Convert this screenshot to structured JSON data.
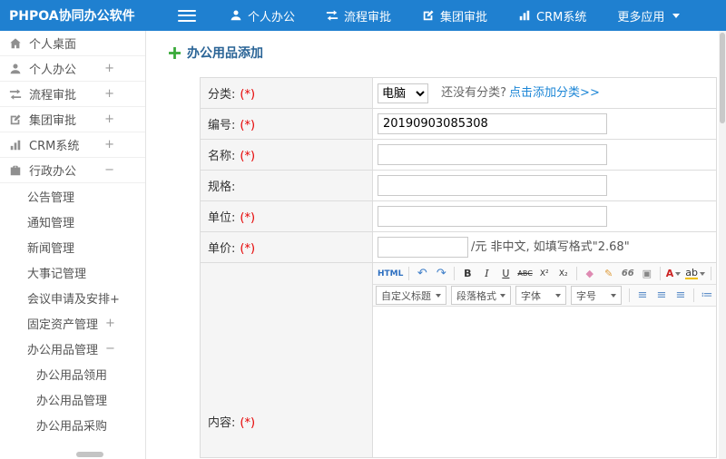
{
  "colors": {
    "topbar": "#1f80d0",
    "link": "#1c86d6",
    "required": "#e60000",
    "title": "#2a6496",
    "plus_icon": "#3aaa3a"
  },
  "topbar": {
    "logo": "PHPOA协同办公软件",
    "menu_icon": "hamburger-icon",
    "nav": [
      {
        "label": "个人办公",
        "icon": "user-icon"
      },
      {
        "label": "流程审批",
        "icon": "flow-icon"
      },
      {
        "label": "集团审批",
        "icon": "edit-icon"
      },
      {
        "label": "CRM系统",
        "icon": "chart-icon"
      },
      {
        "label": "更多应用",
        "icon": "caret-down-icon"
      }
    ]
  },
  "sidebar": {
    "items": [
      {
        "label": "个人桌面",
        "icon": "desktop-icon",
        "suffix": ""
      },
      {
        "label": "个人办公",
        "icon": "user-icon",
        "suffix": "+"
      },
      {
        "label": "流程审批",
        "icon": "flow-icon",
        "suffix": "+"
      },
      {
        "label": "集团审批",
        "icon": "edit-icon",
        "suffix": "+"
      },
      {
        "label": "CRM系统",
        "icon": "chart-icon",
        "suffix": "+"
      },
      {
        "label": "行政办公",
        "icon": "office-icon",
        "suffix": "−"
      },
      {
        "label": "公告管理",
        "suffix": ""
      },
      {
        "label": "通知管理",
        "suffix": ""
      },
      {
        "label": "新闻管理",
        "suffix": ""
      },
      {
        "label": "大事记管理",
        "suffix": ""
      },
      {
        "label": "会议申请及安排+",
        "suffix": ""
      },
      {
        "label": "固定资产管理",
        "suffix": "+"
      },
      {
        "label": "办公用品管理",
        "suffix": "−"
      },
      {
        "label": "办公用品领用",
        "suffix": ""
      },
      {
        "label": "办公用品管理",
        "suffix": ""
      },
      {
        "label": "办公用品采购",
        "suffix": ""
      }
    ]
  },
  "page": {
    "title": "办公用品添加",
    "title_icon": "add-plus-icon"
  },
  "form": {
    "required_mark": "(*)",
    "category": {
      "label": "分类:",
      "selected": "电脑",
      "hint": "还没有分类?",
      "add_link": "点击添加分类>>"
    },
    "number": {
      "label": "编号:",
      "value": "20190903085308"
    },
    "name": {
      "label": "名称:"
    },
    "spec": {
      "label": "规格:"
    },
    "unit": {
      "label": "单位:"
    },
    "price": {
      "label": "单价:",
      "suffix": "/元 非中文, 如填写格式\"2.68\""
    },
    "content": {
      "label": "内容:"
    }
  },
  "editor": {
    "row1": [
      {
        "name": "html-source-button",
        "glyph": "HTML"
      },
      {
        "name": "undo-button",
        "glyph": "↶"
      },
      {
        "name": "redo-button",
        "glyph": "↷"
      },
      {
        "name": "bold-button",
        "glyph": "B"
      },
      {
        "name": "italic-button",
        "glyph": "I"
      },
      {
        "name": "underline-button",
        "glyph": "U"
      },
      {
        "name": "strikethrough-button",
        "glyph": "ABC"
      },
      {
        "name": "superscript-button",
        "glyph": "X²"
      },
      {
        "name": "subscript-button",
        "glyph": "X₂"
      },
      {
        "name": "remove-format-button",
        "glyph": "◆"
      },
      {
        "name": "format-brush-button",
        "glyph": "✎"
      },
      {
        "name": "blockquote-button",
        "glyph": "66"
      },
      {
        "name": "insert-image-button",
        "glyph": "▣"
      },
      {
        "name": "font-color-button",
        "glyph": "A"
      },
      {
        "name": "highlight-color-button",
        "glyph": "ab"
      },
      {
        "name": "insert-table-button",
        "glyph": "▦"
      }
    ],
    "row2": {
      "dropdowns": [
        "自定义标题",
        "段落格式",
        "字体",
        "字号"
      ],
      "icons": [
        {
          "name": "align-left-icon",
          "glyph": "≡"
        },
        {
          "name": "align-center-icon",
          "glyph": "≡"
        },
        {
          "name": "align-right-icon",
          "glyph": "≡"
        },
        {
          "name": "ordered-list-icon",
          "glyph": "≔"
        },
        {
          "name": "unordered-list-icon",
          "glyph": "∷"
        }
      ]
    }
  }
}
